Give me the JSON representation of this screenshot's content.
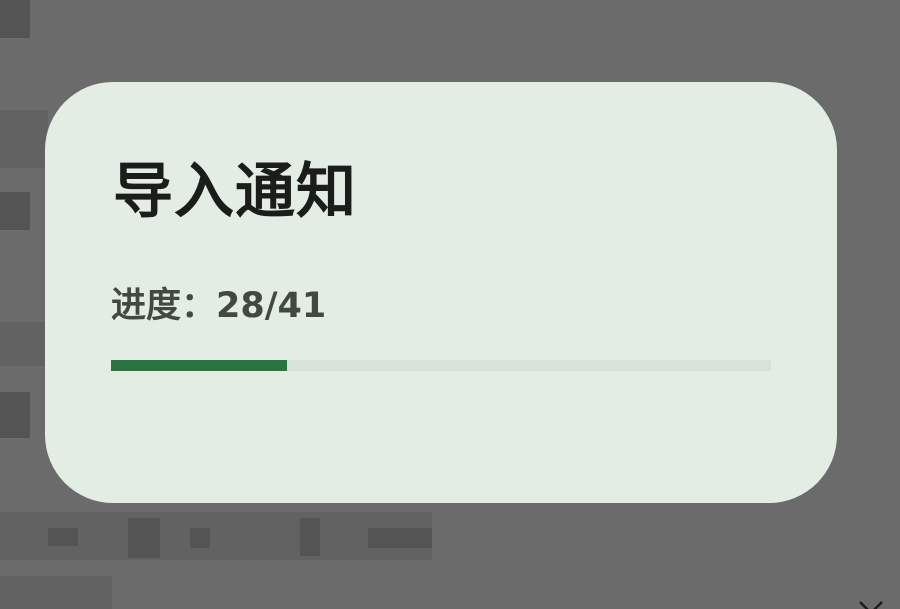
{
  "dialog": {
    "title": "导入通知",
    "progress_label": "进度：",
    "progress_current": 28,
    "progress_total": 41,
    "progress_text": "进度：28/41"
  },
  "colors": {
    "scrim": "#6b6b6b",
    "dialog_background": "#e3ede3",
    "title_text": "#1b1d1b",
    "progress_text": "#424942",
    "progress_track": "#d9e2d9",
    "progress_fill": "#2b7141"
  },
  "icons": {
    "background_close": "close-icon"
  }
}
